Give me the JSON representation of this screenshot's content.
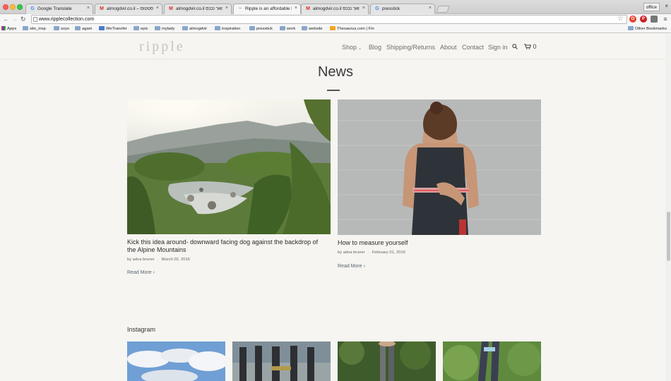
{
  "browser": {
    "tabs": [
      {
        "title": "Google Translate",
        "icon": "google-translate-icon",
        "active": false
      },
      {
        "title": "almogdvir.co.il – סטטוס",
        "icon": "gmail-icon",
        "active": false
      },
      {
        "title": "almogdvir.co.il דואר נכנס",
        "icon": "gmail-icon",
        "active": false
      },
      {
        "title": "Ripple is an affordable hig",
        "icon": "ripple-icon",
        "active": true
      },
      {
        "title": "almogdvir.co.il דואר נכנס",
        "icon": "gmail-icon",
        "active": false
      },
      {
        "title": "presstick",
        "icon": "google-icon",
        "active": false
      }
    ],
    "office_label": "office",
    "url": "www.ripplecollection.com",
    "bookmarks": [
      {
        "label": "Apps",
        "icon": "apps-grid-icon"
      },
      {
        "label": "site_insp",
        "icon": "folder-icon"
      },
      {
        "label": "soyo",
        "icon": "folder-icon"
      },
      {
        "label": "agam",
        "icon": "folder-icon"
      },
      {
        "label": "WeTransfer",
        "icon": "wetransfer-icon"
      },
      {
        "label": "epic",
        "icon": "folder-icon"
      },
      {
        "label": "mylady",
        "icon": "folder-icon"
      },
      {
        "label": "almogdvir",
        "icon": "folder-icon"
      },
      {
        "label": "inspiration",
        "icon": "folder-icon"
      },
      {
        "label": "presstick",
        "icon": "folder-icon"
      },
      {
        "label": "work",
        "icon": "folder-icon"
      },
      {
        "label": "website",
        "icon": "folder-icon"
      },
      {
        "label": "Thesaurus.com | Fin",
        "icon": "thesaurus-icon"
      }
    ],
    "other_bookmarks": "Other Bookmarks"
  },
  "site": {
    "logo": "ripple",
    "nav": [
      "Shop",
      "Blog",
      "Shipping/Returns",
      "About",
      "Contact",
      "Sign in"
    ],
    "cart_count": "0"
  },
  "page": {
    "title": "News",
    "posts": [
      {
        "title": "Kick this idea around- downward facing dog against the backdrop of the Alpine Mountains",
        "author": "by adva bruner",
        "date": "March 02, 2016",
        "read_more": "Read More ›"
      },
      {
        "title": "How to measure yourself",
        "author": "by adva bruner",
        "date": "February 01, 2016",
        "read_more": "Read More ›"
      }
    ],
    "instagram_heading": "Instagram"
  },
  "colors": {
    "page_bg": "#f6f5f1",
    "text_dark": "#2c2c2c",
    "nav_text": "#6e6d6a",
    "link": "#5a6273"
  }
}
